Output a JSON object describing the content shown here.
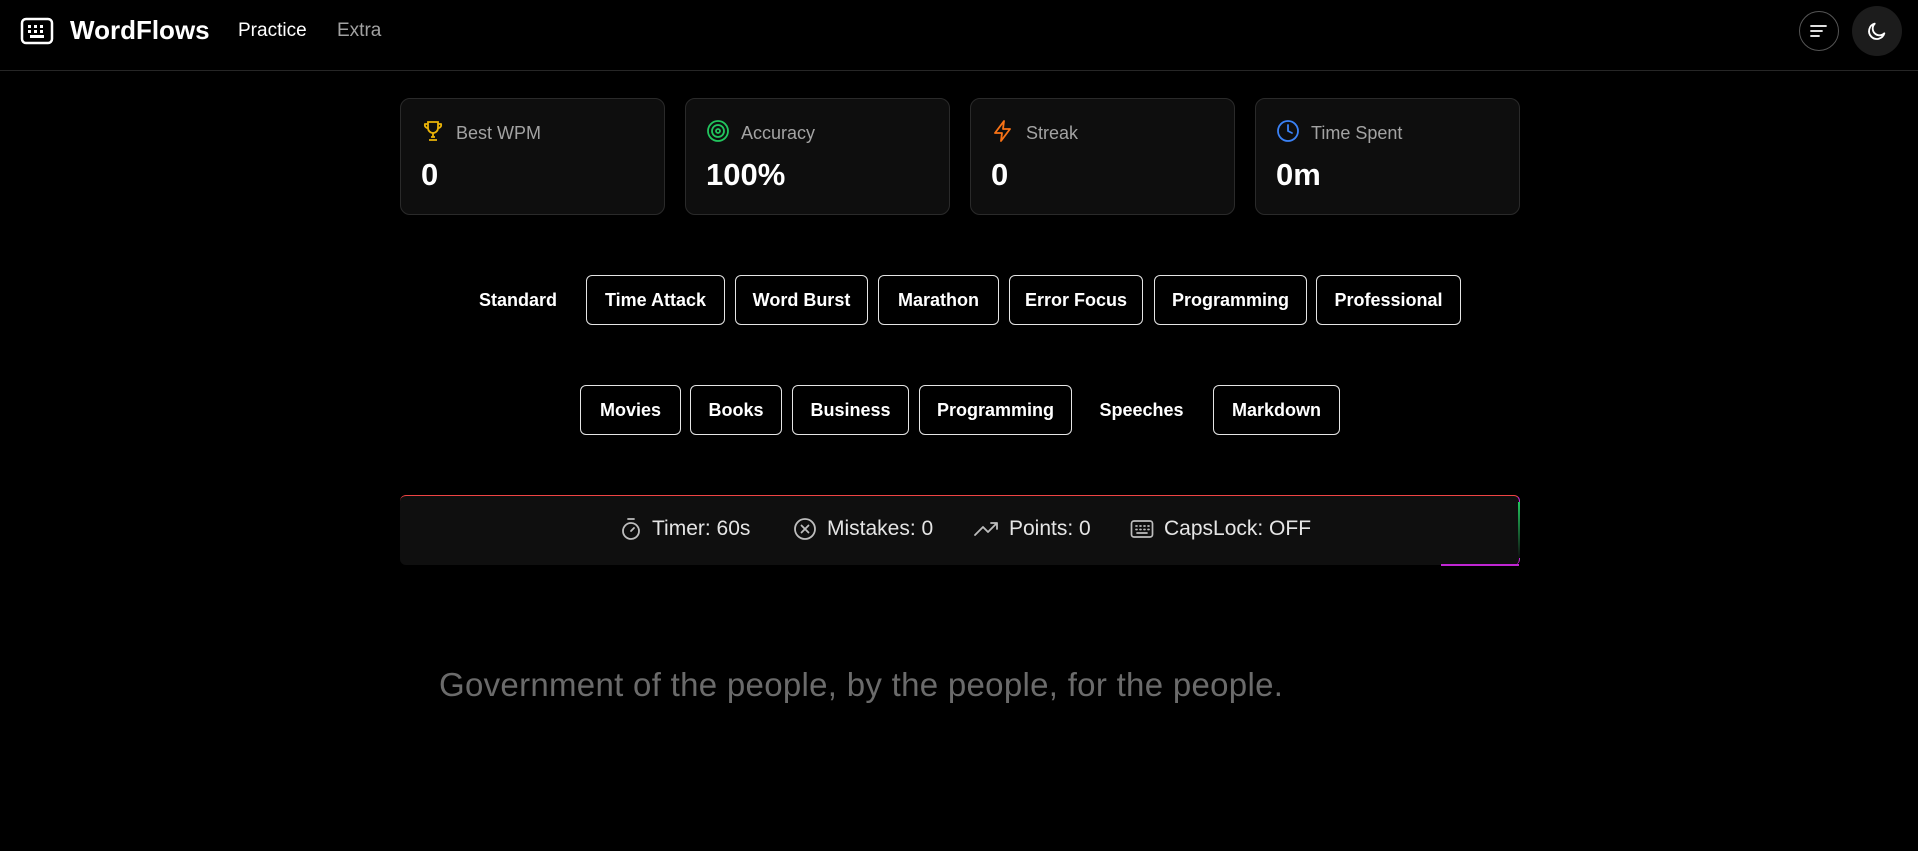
{
  "app": {
    "name": "WordFlows"
  },
  "nav": {
    "practice": "Practice",
    "extra": "Extra"
  },
  "stats": [
    {
      "label": "Best WPM",
      "value": "0",
      "icon": "trophy-icon",
      "color": "#eab308"
    },
    {
      "label": "Accuracy",
      "value": "100%",
      "icon": "target-icon",
      "color": "#22c55e"
    },
    {
      "label": "Streak",
      "value": "0",
      "icon": "zap-icon",
      "color": "#f97316"
    },
    {
      "label": "Time Spent",
      "value": "0m",
      "icon": "clock-icon",
      "color": "#3b82f6"
    }
  ],
  "modes": [
    "Standard",
    "Time Attack",
    "Word Burst",
    "Marathon",
    "Error Focus",
    "Programming",
    "Professional"
  ],
  "active_mode": "Standard",
  "categories": [
    "Movies",
    "Books",
    "Business",
    "Programming",
    "Speeches",
    "Markdown"
  ],
  "active_category": "Speeches",
  "session": {
    "timer": "Timer: 60s",
    "mistakes": "Mistakes: 0",
    "points": "Points: 0",
    "capslock": "CapsLock: OFF"
  },
  "prompt": "Government of the people, by the people, for the people."
}
